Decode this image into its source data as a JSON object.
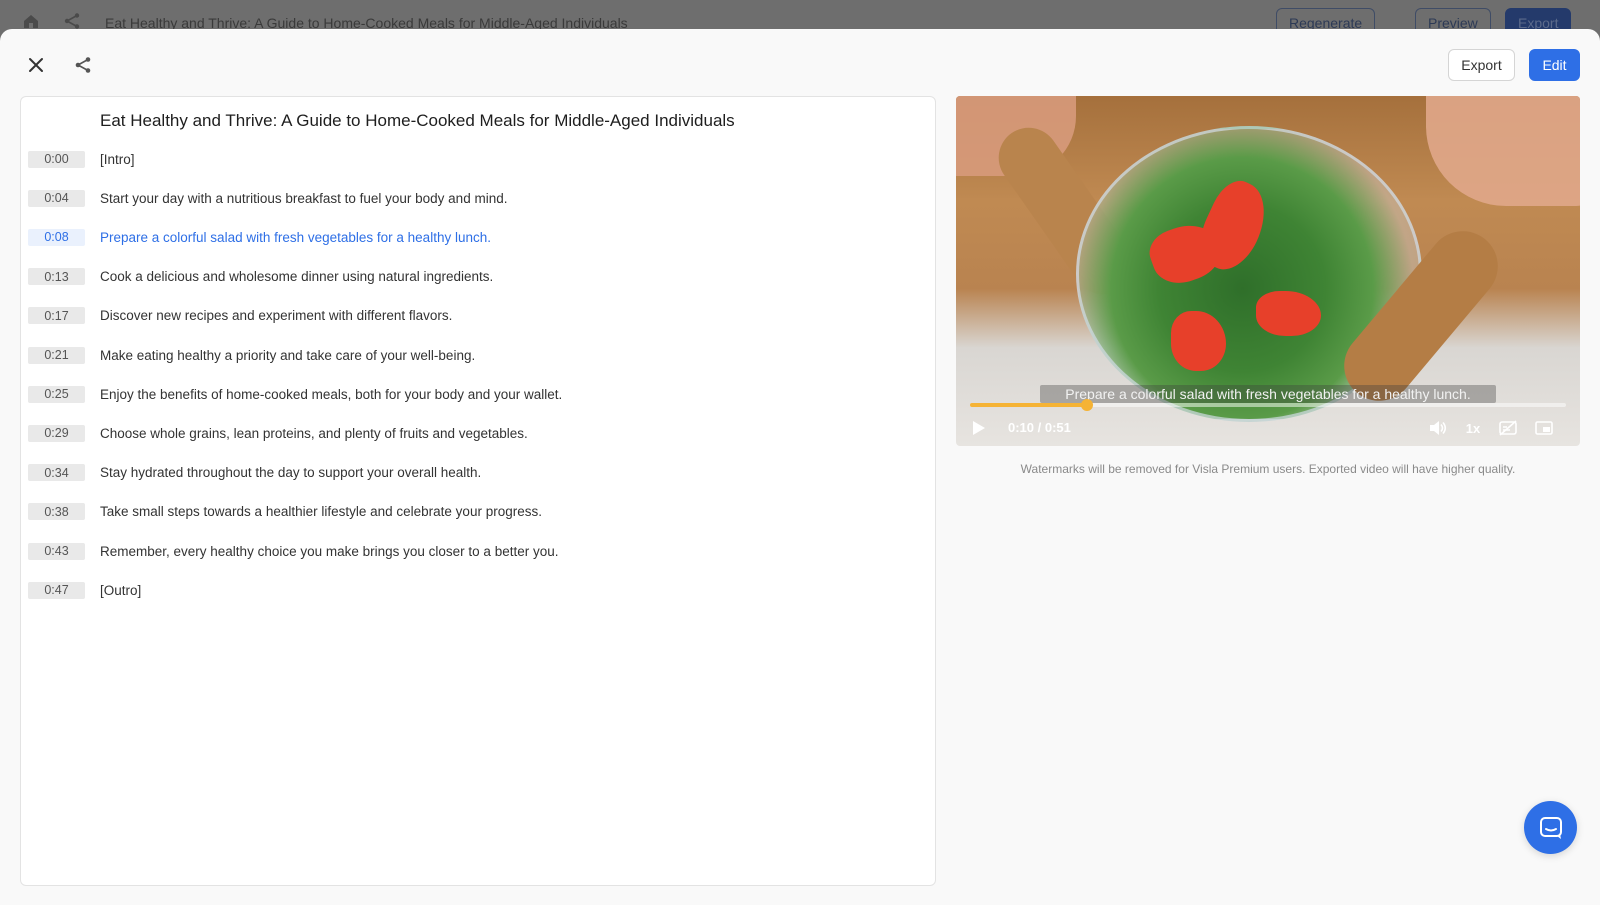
{
  "background": {
    "title": "Eat Healthy and Thrive: A Guide to Home-Cooked Meals for Middle-Aged Individuals",
    "regenerate_label": "Regenerate",
    "preview_label": "Preview",
    "export_label": "Export",
    "icons": [
      "home-icon",
      "share-icon"
    ]
  },
  "header": {
    "close_icon": "close-icon",
    "share_icon": "share-icon",
    "export_label": "Export",
    "edit_label": "Edit"
  },
  "transcript": {
    "title": "Eat Healthy and Thrive: A Guide to Home-Cooked Meals for Middle-Aged Individuals",
    "active_index": 2,
    "lines": [
      {
        "time": "0:00",
        "text": "[Intro]"
      },
      {
        "time": "0:04",
        "text": "Start your day with a nutritious breakfast to fuel your body and mind."
      },
      {
        "time": "0:08",
        "text": "Prepare a colorful salad with fresh vegetables for a healthy lunch."
      },
      {
        "time": "0:13",
        "text": "Cook a delicious and wholesome dinner using natural ingredients."
      },
      {
        "time": "0:17",
        "text": "Discover new recipes and experiment with different flavors."
      },
      {
        "time": "0:21",
        "text": "Make eating healthy a priority and take care of your well-being."
      },
      {
        "time": "0:25",
        "text": "Enjoy the benefits of home-cooked meals, both for your body and your wallet."
      },
      {
        "time": "0:29",
        "text": "Choose whole grains, lean proteins, and plenty of fruits and vegetables."
      },
      {
        "time": "0:34",
        "text": "Stay hydrated throughout the day to support your overall health."
      },
      {
        "time": "0:38",
        "text": "Take small steps towards a healthier lifestyle and celebrate your progress."
      },
      {
        "time": "0:43",
        "text": "Remember, every healthy choice you make brings you closer to a better you."
      },
      {
        "time": "0:47",
        "text": "[Outro]"
      }
    ]
  },
  "player": {
    "caption": "Prepare a colorful salad with fresh vegetables for a healthy lunch.",
    "time_display": "0:10 / 0:51",
    "progress": 0.196,
    "speed": "1x",
    "icons": [
      "play-icon",
      "volume-icon",
      "captions-off-icon",
      "picture-in-picture-icon"
    ],
    "accent_color": "#f5b335"
  },
  "watermark_note": "Watermarks will be removed for Visla Premium users. Exported video will have higher quality.",
  "chat": {
    "icon": "chat-icon"
  },
  "colors": {
    "primary": "#2e6fe6",
    "active_text": "#2e6fe6"
  }
}
